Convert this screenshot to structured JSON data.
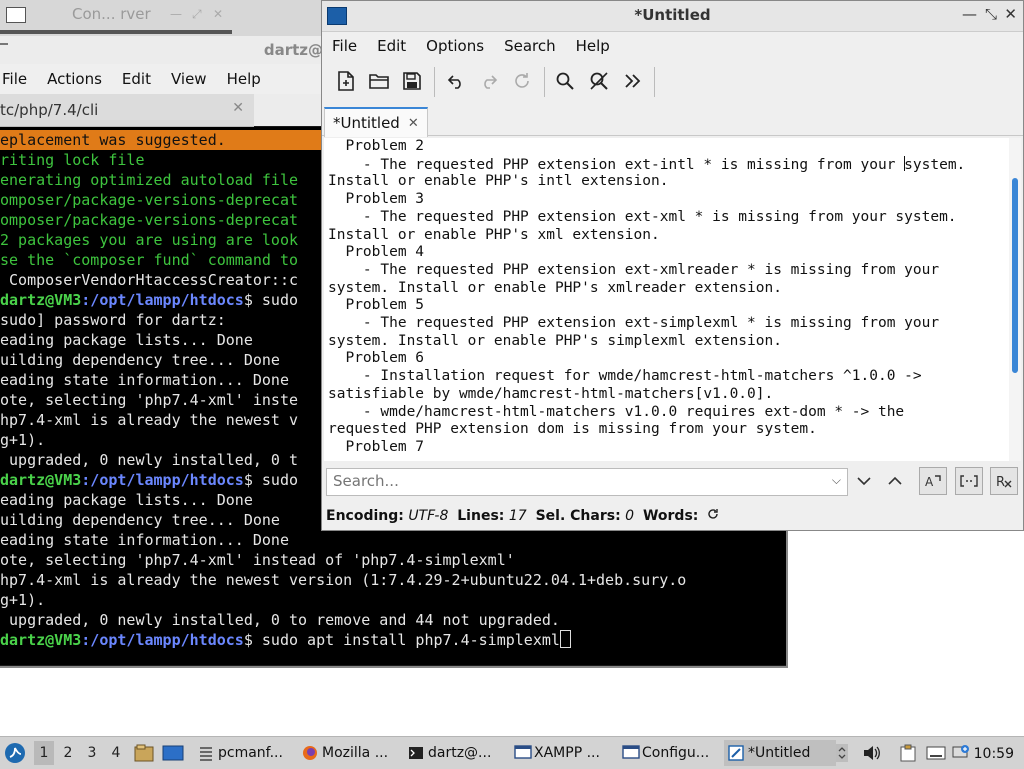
{
  "background_window": {
    "title": "Con...  rver"
  },
  "terminal": {
    "title": "dartz@",
    "menu": [
      "File",
      "Actions",
      "Edit",
      "View",
      "Help"
    ],
    "tab_label": "tc/php/7.4/cli",
    "lines": [
      {
        "text": "eplacement was suggested.",
        "style": "hl"
      },
      {
        "text": "riting lock file",
        "style": "green"
      },
      {
        "text": "enerating optimized autoload file",
        "style": "green"
      },
      {
        "text": "omposer/package-versions-deprecat",
        "style": "green"
      },
      {
        "text": "omposer/package-versions-deprecat",
        "style": "green"
      },
      {
        "text": "2 packages you are using are look",
        "style": "green"
      },
      {
        "text": "se the `composer fund` command to",
        "style": "green"
      },
      {
        "text": " ComposerVendorHtaccessCreator::c",
        "style": "plain"
      },
      {
        "user": "dartz@VM3",
        "path": ":/opt/lampp/htdocs",
        "cmd": "$ sudo",
        "style": "prompt"
      },
      {
        "text": "sudo] password for dartz:",
        "style": "plain"
      },
      {
        "text": "eading package lists... Done",
        "style": "plain"
      },
      {
        "text": "uilding dependency tree... Done",
        "style": "plain"
      },
      {
        "text": "eading state information... Done",
        "style": "plain"
      },
      {
        "text": "ote, selecting 'php7.4-xml' inste",
        "style": "plain"
      },
      {
        "text": "hp7.4-xml is already the newest v",
        "style": "plain"
      },
      {
        "text": "g+1).",
        "style": "plain"
      },
      {
        "text": " upgraded, 0 newly installed, 0 t",
        "style": "plain"
      },
      {
        "user": "dartz@VM3",
        "path": ":/opt/lampp/htdocs",
        "cmd": "$ sudo",
        "style": "prompt"
      },
      {
        "text": "eading package lists... Done",
        "style": "plain"
      },
      {
        "text": "uilding dependency tree... Done",
        "style": "plain"
      },
      {
        "text": "eading state information... Done",
        "style": "plain"
      },
      {
        "text": "ote, selecting 'php7.4-xml' instead of 'php7.4-simplexml'",
        "style": "plain"
      },
      {
        "text": "hp7.4-xml is already the newest version (1:7.4.29-2+ubuntu22.04.1+deb.sury.o",
        "style": "plain"
      },
      {
        "text": "g+1).",
        "style": "plain"
      },
      {
        "text": " upgraded, 0 newly installed, 0 to remove and 44 not upgraded.",
        "style": "plain"
      },
      {
        "user": "dartz@VM3",
        "path": ":/opt/lampp/htdocs",
        "cmd": "$ sudo apt install php7.4-simplexml",
        "style": "prompt-cursor"
      }
    ]
  },
  "editor": {
    "title": "*Untitled",
    "menu": [
      "File",
      "Edit",
      "Options",
      "Search",
      "Help"
    ],
    "toolbar_icons": [
      "new-file-icon",
      "open-folder-icon",
      "save-icon",
      "undo-icon",
      "redo-icon",
      "reload-icon",
      "find-icon",
      "replace-icon",
      "more-icon"
    ],
    "tab_label": "*Untitled",
    "lines": [
      "  Problem 2",
      "    - The requested PHP extension ext-intl * is missing from your |system.",
      "Install or enable PHP's intl extension.",
      "  Problem 3",
      "    - The requested PHP extension ext-xml * is missing from your system.",
      "Install or enable PHP's xml extension.",
      "  Problem 4",
      "    - The requested PHP extension ext-xmlreader * is missing from your",
      "system. Install or enable PHP's xmlreader extension.",
      "  Problem 5",
      "    - The requested PHP extension ext-simplexml * is missing from your",
      "system. Install or enable PHP's simplexml extension.",
      "  Problem 6",
      "    - Installation request for wmde/hamcrest-html-matchers ^1.0.0 ->",
      "satisfiable by wmde/hamcrest-html-matchers[v1.0.0].",
      "    - wmde/hamcrest-html-matchers v1.0.0 requires ext-dom * -> the",
      "requested PHP extension dom is missing from your system.",
      "  Problem 7"
    ],
    "search_placeholder": "Search...",
    "status": {
      "encoding_label": "Encoding:",
      "encoding": "UTF-8",
      "lines_label": "Lines:",
      "lines": "17",
      "sel_label": "Sel. Chars:",
      "sel": "0",
      "words_label": "Words:"
    }
  },
  "taskbar": {
    "desktops": [
      "1",
      "2",
      "3",
      "4"
    ],
    "tasks": [
      "pcmanf...",
      "Mozilla ...",
      "dartz@...",
      "XAMPP ...",
      "Configu...",
      "*Untitled"
    ],
    "clock": "10:59"
  }
}
